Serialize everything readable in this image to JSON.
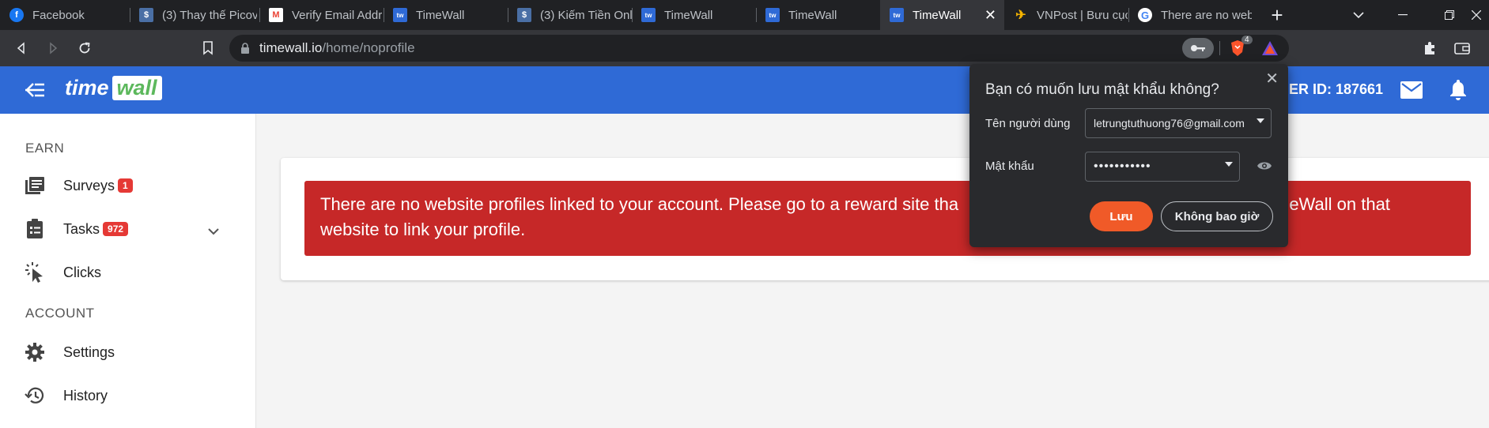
{
  "tabs": [
    {
      "title": "Facebook",
      "favicon": "facebook-icon",
      "color": "#1877f2"
    },
    {
      "title": "(3) Thay thế Picov",
      "favicon": "game-icon",
      "color": "#4a6fa5"
    },
    {
      "title": "Verify Email Addr",
      "favicon": "gmail-icon",
      "color": "#ea4335"
    },
    {
      "title": "TimeWall",
      "favicon": "timewall-icon",
      "color": "#2f6ad6"
    },
    {
      "title": "(3) Kiếm Tiền Onl",
      "favicon": "game-icon",
      "color": "#4a6fa5"
    },
    {
      "title": "TimeWall",
      "favicon": "timewall-icon",
      "color": "#2f6ad6"
    },
    {
      "title": "TimeWall",
      "favicon": "timewall-icon",
      "color": "#2f6ad6"
    },
    {
      "title": "TimeWall",
      "favicon": "timewall-icon",
      "color": "#2f6ad6",
      "active": true
    },
    {
      "title": "VNPost | Bưu cục",
      "favicon": "vnpost-icon",
      "color": "#f5b400"
    },
    {
      "title": "There are no web",
      "favicon": "google-icon",
      "color": "#4285f4"
    }
  ],
  "toolbar": {
    "url_host": "timewall.io",
    "url_path": "/home/noprofile",
    "brave_count": "4"
  },
  "header": {
    "logo_time": "time",
    "logo_wall": "wall",
    "user_id_text": "ER ID: 187661"
  },
  "sidebar": {
    "earn_title": "EARN",
    "account_title": "ACCOUNT",
    "surveys": {
      "label": "Surveys",
      "badge": "1"
    },
    "tasks": {
      "label": "Tasks",
      "badge": "972"
    },
    "clicks": {
      "label": "Clicks"
    },
    "settings": {
      "label": "Settings"
    },
    "history": {
      "label": "History"
    }
  },
  "main": {
    "alert_line1_a": "There are no website profiles linked to your account. Please go to a reward site tha",
    "alert_line1_b": "meWall on that",
    "alert_line2": "website to link your profile."
  },
  "password_prompt": {
    "title": "Bạn có muốn lưu mật khẩu không?",
    "username_label": "Tên người dùng",
    "username_value": "letrungtuthuong76@gmail.com",
    "password_label": "Mật khẩu",
    "password_value": "•••••••••••",
    "save_label": "Lưu",
    "never_label": "Không bao giờ"
  },
  "colors": {
    "brand_blue": "#2f6ad6",
    "alert_red": "#c62828",
    "save_orange": "#f05a28",
    "badge_red": "#e53935"
  }
}
